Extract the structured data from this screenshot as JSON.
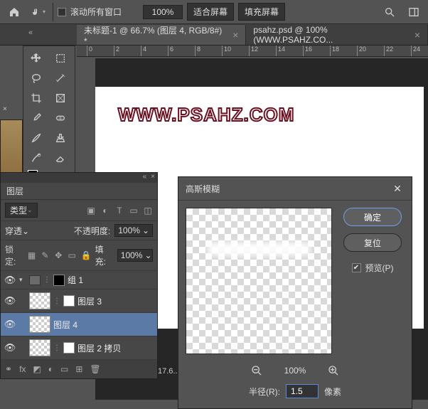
{
  "topbar": {
    "scroll_all_windows": "滚动所有窗口",
    "zoom": "100%",
    "fit_screen": "适合屏幕",
    "fill_screen": "填充屏幕"
  },
  "tabs": [
    {
      "label": "未标题-1 @ 66.7% (图层 4, RGB/8#) *"
    },
    {
      "label": "psahz.psd @ 100% (WWW.PSAHZ.CO..."
    }
  ],
  "ruler_ticks": [
    "0",
    "2",
    "4",
    "6",
    "8",
    "10",
    "12",
    "14",
    "16",
    "18",
    "20",
    "22",
    "24"
  ],
  "canvas_text": "WWW.PSAHZ.COM",
  "layers_panel": {
    "tab": "图层",
    "kind_label": "类型",
    "blend_mode": "穿透",
    "opacity_label": "不透明度:",
    "opacity_value": "100%",
    "lock_label": "锁定:",
    "fill_label": "填充:",
    "fill_value": "100%",
    "items": [
      {
        "name": "组 1",
        "type": "group"
      },
      {
        "name": "图层 3",
        "type": "layer"
      },
      {
        "name": "图层 4",
        "type": "layer",
        "selected": true
      },
      {
        "name": "图层 2 拷贝",
        "type": "layer"
      }
    ]
  },
  "status_fragment": "17.6...",
  "dialog": {
    "title": "高斯模糊",
    "ok": "确定",
    "reset": "复位",
    "preview": "预览(P)",
    "zoom": "100%",
    "radius_label": "半径(R):",
    "radius_value": "1.5",
    "radius_unit": "像素"
  }
}
